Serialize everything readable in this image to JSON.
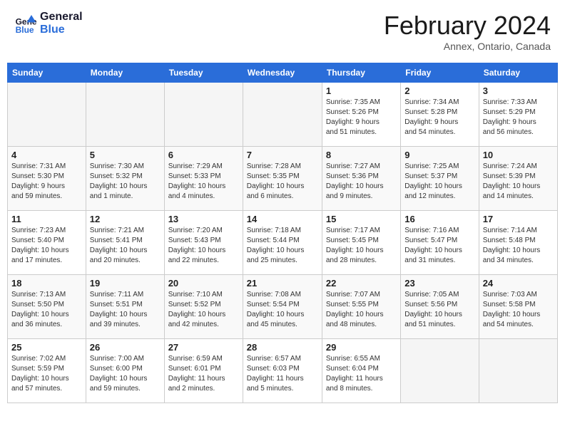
{
  "header": {
    "logo_line1": "General",
    "logo_line2": "Blue",
    "title": "February 2024",
    "subtitle": "Annex, Ontario, Canada"
  },
  "weekdays": [
    "Sunday",
    "Monday",
    "Tuesday",
    "Wednesday",
    "Thursday",
    "Friday",
    "Saturday"
  ],
  "weeks": [
    [
      {
        "day": "",
        "info": ""
      },
      {
        "day": "",
        "info": ""
      },
      {
        "day": "",
        "info": ""
      },
      {
        "day": "",
        "info": ""
      },
      {
        "day": "1",
        "info": "Sunrise: 7:35 AM\nSunset: 5:26 PM\nDaylight: 9 hours\nand 51 minutes."
      },
      {
        "day": "2",
        "info": "Sunrise: 7:34 AM\nSunset: 5:28 PM\nDaylight: 9 hours\nand 54 minutes."
      },
      {
        "day": "3",
        "info": "Sunrise: 7:33 AM\nSunset: 5:29 PM\nDaylight: 9 hours\nand 56 minutes."
      }
    ],
    [
      {
        "day": "4",
        "info": "Sunrise: 7:31 AM\nSunset: 5:30 PM\nDaylight: 9 hours\nand 59 minutes."
      },
      {
        "day": "5",
        "info": "Sunrise: 7:30 AM\nSunset: 5:32 PM\nDaylight: 10 hours\nand 1 minute."
      },
      {
        "day": "6",
        "info": "Sunrise: 7:29 AM\nSunset: 5:33 PM\nDaylight: 10 hours\nand 4 minutes."
      },
      {
        "day": "7",
        "info": "Sunrise: 7:28 AM\nSunset: 5:35 PM\nDaylight: 10 hours\nand 6 minutes."
      },
      {
        "day": "8",
        "info": "Sunrise: 7:27 AM\nSunset: 5:36 PM\nDaylight: 10 hours\nand 9 minutes."
      },
      {
        "day": "9",
        "info": "Sunrise: 7:25 AM\nSunset: 5:37 PM\nDaylight: 10 hours\nand 12 minutes."
      },
      {
        "day": "10",
        "info": "Sunrise: 7:24 AM\nSunset: 5:39 PM\nDaylight: 10 hours\nand 14 minutes."
      }
    ],
    [
      {
        "day": "11",
        "info": "Sunrise: 7:23 AM\nSunset: 5:40 PM\nDaylight: 10 hours\nand 17 minutes."
      },
      {
        "day": "12",
        "info": "Sunrise: 7:21 AM\nSunset: 5:41 PM\nDaylight: 10 hours\nand 20 minutes."
      },
      {
        "day": "13",
        "info": "Sunrise: 7:20 AM\nSunset: 5:43 PM\nDaylight: 10 hours\nand 22 minutes."
      },
      {
        "day": "14",
        "info": "Sunrise: 7:18 AM\nSunset: 5:44 PM\nDaylight: 10 hours\nand 25 minutes."
      },
      {
        "day": "15",
        "info": "Sunrise: 7:17 AM\nSunset: 5:45 PM\nDaylight: 10 hours\nand 28 minutes."
      },
      {
        "day": "16",
        "info": "Sunrise: 7:16 AM\nSunset: 5:47 PM\nDaylight: 10 hours\nand 31 minutes."
      },
      {
        "day": "17",
        "info": "Sunrise: 7:14 AM\nSunset: 5:48 PM\nDaylight: 10 hours\nand 34 minutes."
      }
    ],
    [
      {
        "day": "18",
        "info": "Sunrise: 7:13 AM\nSunset: 5:50 PM\nDaylight: 10 hours\nand 36 minutes."
      },
      {
        "day": "19",
        "info": "Sunrise: 7:11 AM\nSunset: 5:51 PM\nDaylight: 10 hours\nand 39 minutes."
      },
      {
        "day": "20",
        "info": "Sunrise: 7:10 AM\nSunset: 5:52 PM\nDaylight: 10 hours\nand 42 minutes."
      },
      {
        "day": "21",
        "info": "Sunrise: 7:08 AM\nSunset: 5:54 PM\nDaylight: 10 hours\nand 45 minutes."
      },
      {
        "day": "22",
        "info": "Sunrise: 7:07 AM\nSunset: 5:55 PM\nDaylight: 10 hours\nand 48 minutes."
      },
      {
        "day": "23",
        "info": "Sunrise: 7:05 AM\nSunset: 5:56 PM\nDaylight: 10 hours\nand 51 minutes."
      },
      {
        "day": "24",
        "info": "Sunrise: 7:03 AM\nSunset: 5:58 PM\nDaylight: 10 hours\nand 54 minutes."
      }
    ],
    [
      {
        "day": "25",
        "info": "Sunrise: 7:02 AM\nSunset: 5:59 PM\nDaylight: 10 hours\nand 57 minutes."
      },
      {
        "day": "26",
        "info": "Sunrise: 7:00 AM\nSunset: 6:00 PM\nDaylight: 10 hours\nand 59 minutes."
      },
      {
        "day": "27",
        "info": "Sunrise: 6:59 AM\nSunset: 6:01 PM\nDaylight: 11 hours\nand 2 minutes."
      },
      {
        "day": "28",
        "info": "Sunrise: 6:57 AM\nSunset: 6:03 PM\nDaylight: 11 hours\nand 5 minutes."
      },
      {
        "day": "29",
        "info": "Sunrise: 6:55 AM\nSunset: 6:04 PM\nDaylight: 11 hours\nand 8 minutes."
      },
      {
        "day": "",
        "info": ""
      },
      {
        "day": "",
        "info": ""
      }
    ]
  ]
}
